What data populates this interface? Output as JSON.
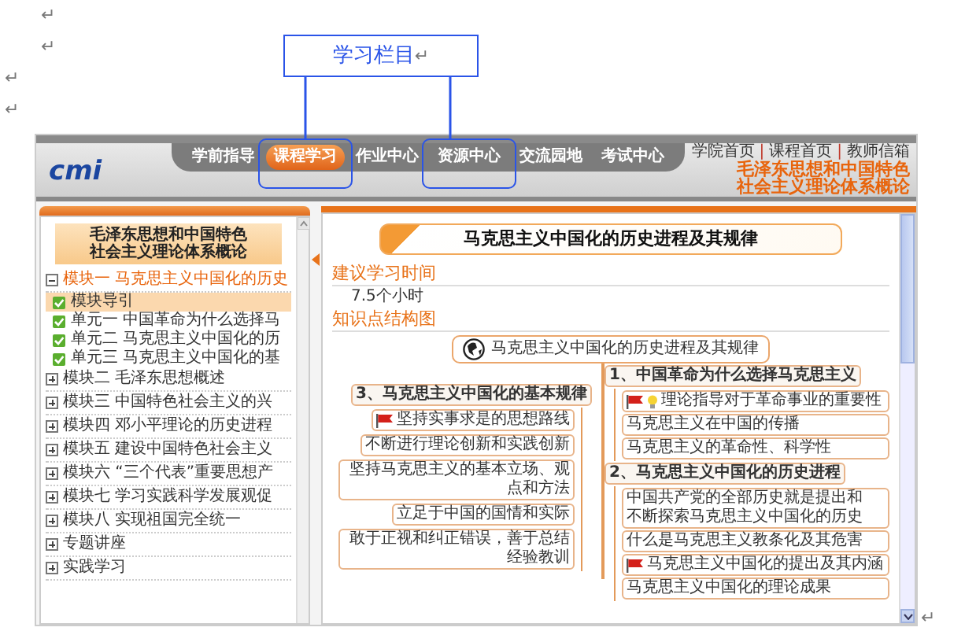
{
  "indented_paragraph_marks": [
    "↵",
    "↵"
  ],
  "paragraph_marks": [
    "↵",
    "↵"
  ],
  "callout": {
    "text": "学习栏目",
    "mark": "↵"
  },
  "header": {
    "logo": "cmi",
    "nav": [
      {
        "label": "学前指导",
        "selected": false,
        "highlighted": false
      },
      {
        "label": "课程学习",
        "selected": true,
        "highlighted": true
      },
      {
        "label": "作业中心",
        "selected": false,
        "highlighted": false
      },
      {
        "label": "资源中心",
        "selected": false,
        "highlighted": true
      },
      {
        "label": "交流园地",
        "selected": false,
        "highlighted": false
      },
      {
        "label": "考试中心",
        "selected": false,
        "highlighted": false
      }
    ],
    "links": [
      "学院首页",
      "课程首页",
      "教师信箱"
    ],
    "link_separator": "|",
    "course_title": [
      "毛泽东思想和中国特色",
      "社会主义理论体系概论"
    ]
  },
  "sidebar": {
    "title": [
      "毛泽东思想和中国特色",
      "社会主义理论体系概论"
    ],
    "items": [
      {
        "label": "模块一 马克思主义中国化的历史",
        "expanded": true,
        "children": [
          {
            "label": "模块导引",
            "selected": true
          },
          {
            "label": "单元一 中国革命为什么选择马",
            "selected": false
          },
          {
            "label": "单元二 马克思主义中国化的历",
            "selected": false
          },
          {
            "label": "单元三 马克思主义中国化的基",
            "selected": false
          }
        ]
      },
      {
        "label": "模块二 毛泽东思想概述",
        "expanded": false
      },
      {
        "label": "模块三 中国特色社会主义的兴",
        "expanded": false
      },
      {
        "label": "模块四 邓小平理论的历史进程",
        "expanded": false
      },
      {
        "label": "模块五 建设中国特色社会主义",
        "expanded": false
      },
      {
        "label": "模块六 “三个代表”重要思想产",
        "expanded": false
      },
      {
        "label": "模块七 学习实践科学发展观促",
        "expanded": false
      },
      {
        "label": "模块八 实现祖国完全统一",
        "expanded": false
      },
      {
        "label": "专题讲座",
        "expanded": false
      },
      {
        "label": "实践学习",
        "expanded": false
      }
    ]
  },
  "content": {
    "title": "马克思主义中国化的历史进程及其规律",
    "sections": [
      {
        "heading": "建议学习时间",
        "text": "7.5个小时"
      },
      {
        "heading": "知识点结构图"
      }
    ],
    "mindmap": {
      "root": "马克思主义中国化的历史进程及其规律",
      "right_branches": [
        {
          "text": "1、中国革命为什么选择马克思主义",
          "children": [
            {
              "text": "理论指导对于革命事业的重要性",
              "flag": true,
              "bulb": true
            },
            {
              "text": "马克思主义在中国的传播"
            },
            {
              "text": "马克思主义的革命性、科学性"
            }
          ]
        },
        {
          "text": "2、马克思主义中国化的历史进程",
          "children": [
            {
              "text": "中国共产党的全部历史就是提出和不断探索马克思主义中国化的历史"
            },
            {
              "text": "什么是马克思主义教条化及其危害"
            },
            {
              "text": "马克思主义中国化的提出及其内涵",
              "flag": true
            },
            {
              "text": "马克思主义中国化的理论成果"
            }
          ]
        }
      ],
      "left_branches": [
        {
          "text": "3、马克思主义中国化的基本规律",
          "children": [
            {
              "text": "坚持实事求是的思想路线",
              "flag": true
            },
            {
              "text": "不断进行理论创新和实践创新"
            },
            {
              "text": "坚持马克思主义的基本立场、观点和方法"
            },
            {
              "text": "立足于中国的国情和实际"
            },
            {
              "text": "敢于正视和纠正错误，善于总结经验教训"
            }
          ]
        }
      ]
    }
  },
  "end_mark": "↵"
}
